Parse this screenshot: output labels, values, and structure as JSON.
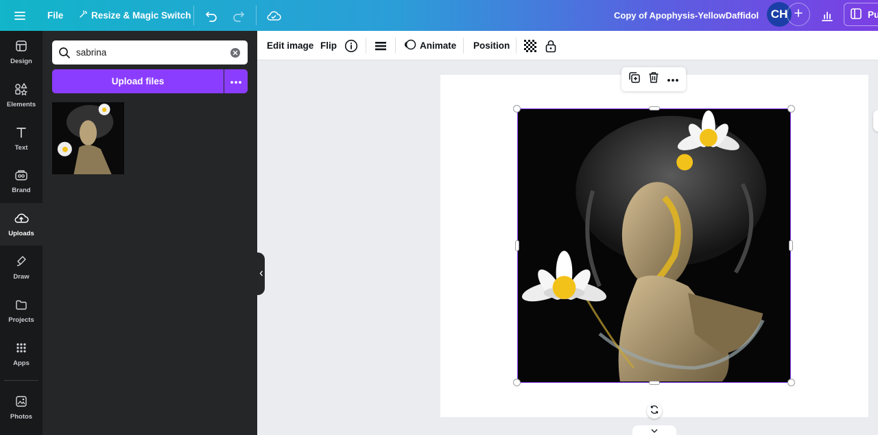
{
  "topbar": {
    "file_label": "File",
    "resize_label": "Resize & Magic Switch",
    "doc_title": "Copy of Apophysis-YellowDaffidol",
    "avatar_initials": "CH",
    "publish_label": "Pu"
  },
  "rail": {
    "items": [
      {
        "label": "Design",
        "icon": "design-icon"
      },
      {
        "label": "Elements",
        "icon": "elements-icon"
      },
      {
        "label": "Text",
        "icon": "text-icon"
      },
      {
        "label": "Brand",
        "icon": "brand-icon"
      },
      {
        "label": "Uploads",
        "icon": "uploads-icon"
      },
      {
        "label": "Draw",
        "icon": "draw-icon"
      },
      {
        "label": "Projects",
        "icon": "projects-icon"
      },
      {
        "label": "Apps",
        "icon": "apps-icon"
      },
      {
        "label": "Photos",
        "icon": "photos-icon"
      }
    ]
  },
  "panel": {
    "search_value": "sabrina",
    "upload_label": "Upload files"
  },
  "toolbar": {
    "edit_image": "Edit image",
    "flip": "Flip",
    "animate": "Animate",
    "position": "Position"
  },
  "colors": {
    "accent": "#8b3dff",
    "rail_bg": "#18191b",
    "panel_bg": "#252627",
    "canvas_bg": "#ebecf0"
  }
}
